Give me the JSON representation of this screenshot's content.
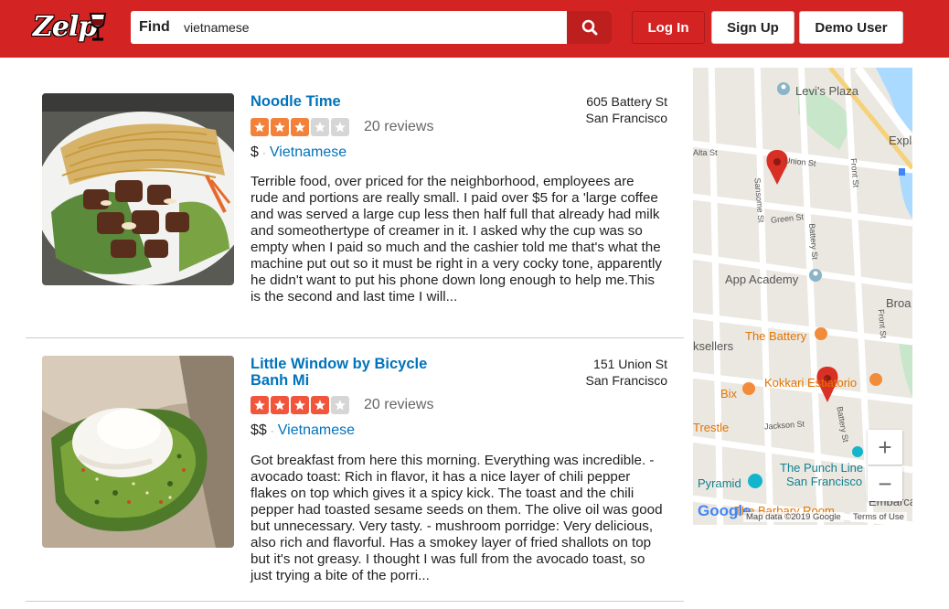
{
  "header": {
    "logo": "Zelp",
    "search_label": "Find",
    "search_value": "vietnamese",
    "login": "Log In",
    "signup": "Sign Up",
    "demo": "Demo User"
  },
  "results": [
    {
      "name": "Noodle Time",
      "address_line1": "605 Battery St",
      "address_line2": "San Francisco",
      "rating": 3,
      "reviews": "20 reviews",
      "price": "$",
      "category": "Vietnamese",
      "snippet": "Terrible food, over priced for the neighborhood, employees are rude and portions are really small. I paid over $5 for a 'large coffee and was served a large cup less then half full that already had milk and someothertype of creamer in it. I asked why the cup was so empty when I paid so much and the cashier told me that's what the machine put out so it must be right in a very cocky tone, apparently he didn't want to put his phone down long enough to help me.This is the second and last time I will..."
    },
    {
      "name": "Little Window by Bicycle Banh Mi",
      "address_line1": "151 Union St",
      "address_line2": "San Francisco",
      "rating": 4,
      "reviews": "20 reviews",
      "price": "$$",
      "category": "Vietnamese",
      "snippet": "Got breakfast from here this morning. Everything was incredible. - avocado toast: Rich in flavor, it has a nice layer of chili pepper flakes on top which gives it a spicy kick. The toast and the chili pepper had toasted sesame seeds on them. The olive oil was good but unnecessary. Very tasty. - mushroom porridge: Very delicious, also rich and flavorful. Has a smokey layer of fried shallots on top but it's not greasy. I thought I was full from the avocado toast, so just trying a bite of the porri..."
    }
  ],
  "map": {
    "places": {
      "levis_plaza": "Levi's Plaza",
      "app_academy": "App Academy",
      "the_battery": "The Battery",
      "kokkari": "Kokkari Estiatorio",
      "bix": "Bix",
      "trestle": "Trestle",
      "pyramid": "Pyramid",
      "punch_line": "The Punch Line",
      "punch_line_2": "San Francisco",
      "sellers": "ksellers",
      "expl": "Expl",
      "broad": "Broa",
      "embarc": "Embarcader",
      "barbary": "The Barbary Room"
    },
    "streets": {
      "union": "Union St",
      "green": "Green St",
      "jackson": "Jackson St",
      "sansome": "Sansome St",
      "battery": "Battery St",
      "battery2": "Battery St",
      "front": "Front St",
      "front2": "Front St",
      "alta": "Alta St"
    },
    "zoom_in": "+",
    "zoom_out": "−",
    "google": "Google",
    "attribution": "Map data ©2019 Google",
    "terms": "Terms of Use",
    "colors": {
      "pin": "#d93025",
      "water": "#aadaff",
      "park": "#c8e6c9",
      "orange_poi": "#f28c3b",
      "blue_poi": "#8ab4c9",
      "teal_poi": "#12b5cb"
    }
  },
  "colors": {
    "brand": "#d32323",
    "link": "#0073bb",
    "star_3": "#f2813a",
    "star_4": "#f1553b",
    "star_empty": "#d6d6d6"
  }
}
